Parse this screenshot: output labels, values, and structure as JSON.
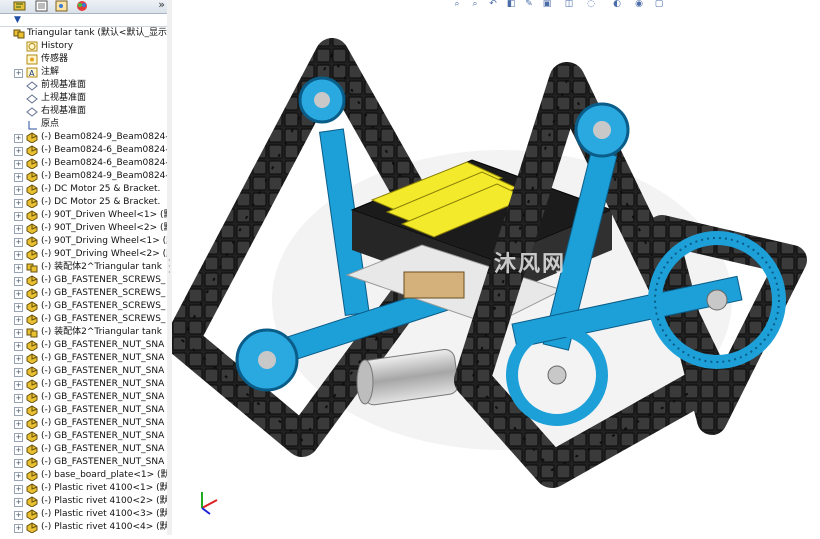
{
  "tabs": {
    "more": "»"
  },
  "tree": {
    "root": "Triangular tank  (默认<默认_显示",
    "items": [
      {
        "label": "History",
        "icon": "history"
      },
      {
        "label": "传感器",
        "icon": "sensor"
      },
      {
        "label": "注解",
        "icon": "annotation"
      },
      {
        "label": "前视基准面",
        "icon": "plane"
      },
      {
        "label": "上视基准面",
        "icon": "plane"
      },
      {
        "label": "右视基准面",
        "icon": "plane"
      },
      {
        "label": "原点",
        "icon": "origin"
      },
      {
        "label": "(-) Beam0824-9_Beam0824-",
        "icon": "part"
      },
      {
        "label": "(-) Beam0824-6_Beam0824-",
        "icon": "part"
      },
      {
        "label": "(-) Beam0824-6_Beam0824-",
        "icon": "part"
      },
      {
        "label": "(-) Beam0824-9_Beam0824-",
        "icon": "part"
      },
      {
        "label": "(-) DC Motor 25 & Bracket.",
        "icon": "part"
      },
      {
        "label": "(-) DC Motor 25 & Bracket.",
        "icon": "part"
      },
      {
        "label": "(-) 90T_Driven Wheel<1> (默",
        "icon": "part"
      },
      {
        "label": "(-) 90T_Driven Wheel<2> (默",
        "icon": "part"
      },
      {
        "label": "(-) 90T_Driving Wheel<1> (默",
        "icon": "part"
      },
      {
        "label": "(-) 90T_Driving Wheel<2> (默",
        "icon": "part"
      },
      {
        "label": "(-) 装配体2^Triangular tank",
        "icon": "assembly"
      },
      {
        "label": "(-) GB_FASTENER_SCREWS_",
        "icon": "part"
      },
      {
        "label": "(-) GB_FASTENER_SCREWS_",
        "icon": "part"
      },
      {
        "label": "(-) GB_FASTENER_SCREWS_",
        "icon": "part"
      },
      {
        "label": "(-) GB_FASTENER_SCREWS_",
        "icon": "part"
      },
      {
        "label": "(-) 装配体2^Triangular tank",
        "icon": "assembly"
      },
      {
        "label": "(-) GB_FASTENER_NUT_SNA",
        "icon": "part"
      },
      {
        "label": "(-) GB_FASTENER_NUT_SNA",
        "icon": "part"
      },
      {
        "label": "(-) GB_FASTENER_NUT_SNA",
        "icon": "part"
      },
      {
        "label": "(-) GB_FASTENER_NUT_SNA",
        "icon": "part"
      },
      {
        "label": "(-) GB_FASTENER_NUT_SNA",
        "icon": "part"
      },
      {
        "label": "(-) GB_FASTENER_NUT_SNA",
        "icon": "part"
      },
      {
        "label": "(-) GB_FASTENER_NUT_SNA",
        "icon": "part"
      },
      {
        "label": "(-) GB_FASTENER_NUT_SNA",
        "icon": "part"
      },
      {
        "label": "(-) GB_FASTENER_NUT_SNA",
        "icon": "part"
      },
      {
        "label": "(-) GB_FASTENER_NUT_SNA",
        "icon": "part"
      },
      {
        "label": "(-) base_board_plate<1> (默",
        "icon": "part"
      },
      {
        "label": "(-) Plastic rivet 4100<1> (默",
        "icon": "part"
      },
      {
        "label": "(-) Plastic rivet 4100<2> (默",
        "icon": "part"
      },
      {
        "label": "(-) Plastic rivet 4100<3> (默",
        "icon": "part"
      },
      {
        "label": "(-) Plastic rivet 4100<4> (默",
        "icon": "part"
      }
    ]
  },
  "viewport": {
    "watermark": "沐风网"
  },
  "colors": {
    "accent": "#1d9fd8",
    "track": "#1a1a1a",
    "battery": "#f2ea2a"
  }
}
